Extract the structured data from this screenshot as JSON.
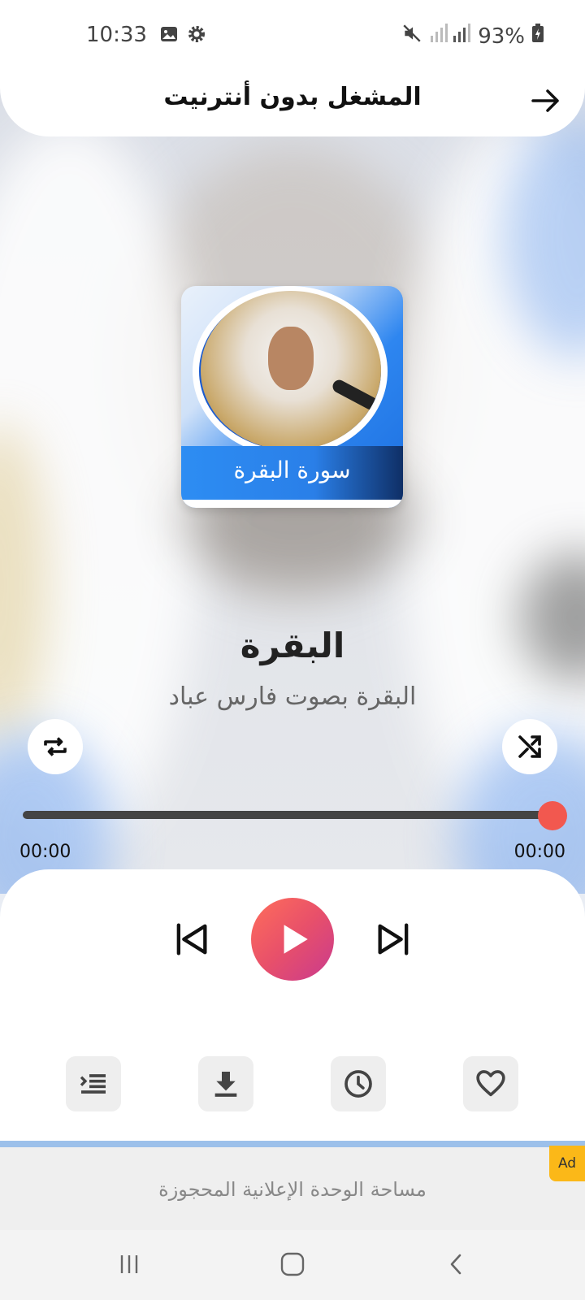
{
  "status_bar": {
    "time": "10:33",
    "battery": "93%",
    "icons": [
      "image-icon",
      "settings-icon",
      "mute-icon",
      "signal-icon",
      "battery-icon"
    ]
  },
  "header": {
    "title": "المشغل بدون أنترنيت",
    "back_icon": "arrow-right-icon"
  },
  "album": {
    "caption": "سورة البقرة"
  },
  "track": {
    "title": "البقرة",
    "subtitle": "البقرة بصوت فارس عباد"
  },
  "playback": {
    "elapsed": "00:00",
    "total": "00:00",
    "progress": 1.0,
    "accent": "#f2584f"
  },
  "controls": {
    "repeat_icon": "repeat-icon",
    "shuffle_icon": "shuffle-icon",
    "prev_icon": "skip-previous-icon",
    "play_icon": "play-icon",
    "next_icon": "skip-next-icon"
  },
  "actions": [
    {
      "name": "queue",
      "icon": "queue-list-icon"
    },
    {
      "name": "download",
      "icon": "download-icon"
    },
    {
      "name": "sleep-timer",
      "icon": "clock-icon"
    },
    {
      "name": "favorite",
      "icon": "heart-icon"
    }
  ],
  "ad": {
    "text": "مساحة الوحدة الإعلانية المحجوزة",
    "badge": "Ad",
    "badge_color": "#fbb818"
  },
  "nav_bar": {
    "icons": [
      "recents-icon",
      "home-icon",
      "back-icon"
    ]
  }
}
